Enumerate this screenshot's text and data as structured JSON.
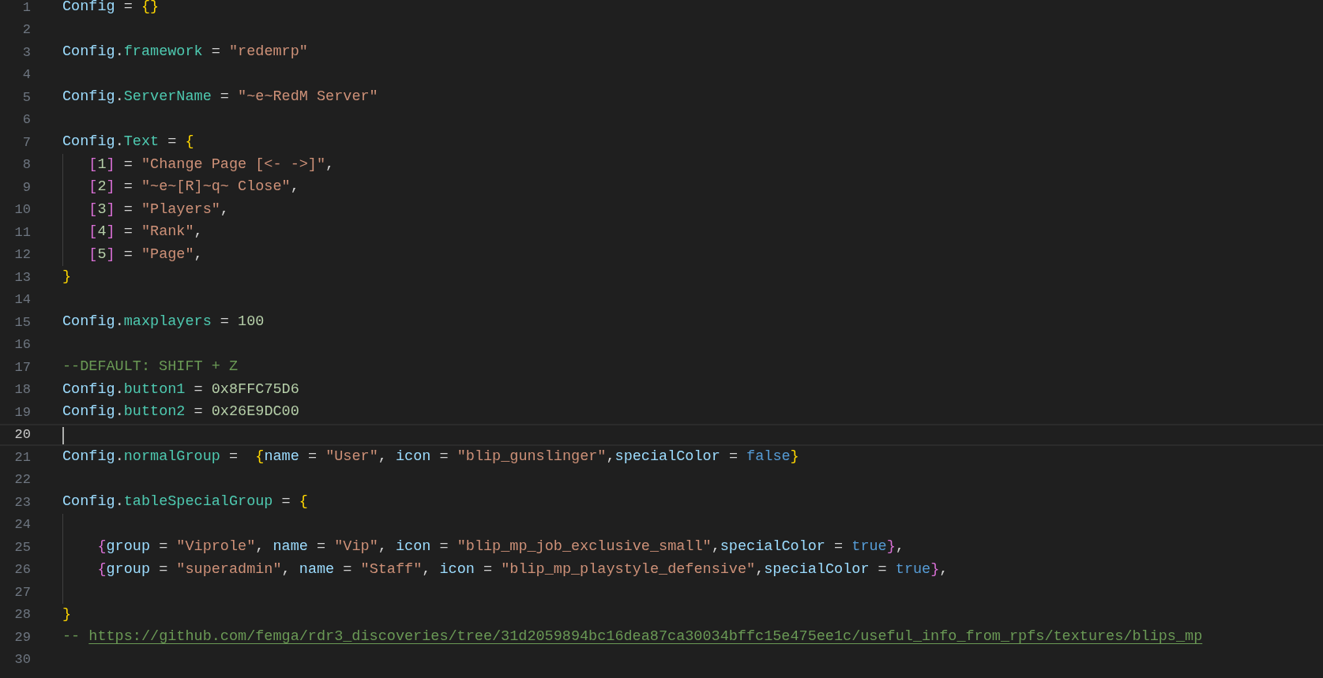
{
  "editor": {
    "lines": [
      {
        "number": "1",
        "current": false,
        "indent_guide": false,
        "tokens": [
          {
            "kind": "v",
            "text": "Config"
          },
          {
            "kind": "o",
            "text": " = "
          },
          {
            "kind": "b1",
            "text": "{}"
          }
        ]
      },
      {
        "number": "2",
        "current": false,
        "indent_guide": false
      },
      {
        "number": "3",
        "current": false,
        "indent_guide": false,
        "tokens": [
          {
            "kind": "v",
            "text": "Config"
          },
          {
            "kind": "o",
            "text": "."
          },
          {
            "kind": "f",
            "text": "framework"
          },
          {
            "kind": "o",
            "text": " = "
          },
          {
            "kind": "s",
            "text": "\"redemrp\""
          }
        ]
      },
      {
        "number": "4",
        "current": false,
        "indent_guide": false
      },
      {
        "number": "5",
        "current": false,
        "indent_guide": false,
        "tokens": [
          {
            "kind": "v",
            "text": "Config"
          },
          {
            "kind": "o",
            "text": "."
          },
          {
            "kind": "f",
            "text": "ServerName"
          },
          {
            "kind": "o",
            "text": " = "
          },
          {
            "kind": "s",
            "text": "\"~e~RedM Server\""
          }
        ]
      },
      {
        "number": "6",
        "current": false,
        "indent_guide": false
      },
      {
        "number": "7",
        "current": false,
        "indent_guide": false,
        "tokens": [
          {
            "kind": "v",
            "text": "Config"
          },
          {
            "kind": "o",
            "text": "."
          },
          {
            "kind": "f",
            "text": "Text"
          },
          {
            "kind": "o",
            "text": " = "
          },
          {
            "kind": "b1",
            "text": "{"
          }
        ]
      },
      {
        "number": "8",
        "current": false,
        "indent_guide": true,
        "kind": "entry",
        "tokens": [
          {
            "kind": "b2",
            "text": "["
          },
          {
            "kind": "n",
            "text": "1"
          },
          {
            "kind": "b2",
            "text": "]"
          },
          {
            "kind": "o",
            "text": " = "
          },
          {
            "kind": "s",
            "text": "\"Change Page [<- ->]\""
          },
          {
            "kind": "o",
            "text": ","
          }
        ]
      },
      {
        "number": "9",
        "current": false,
        "indent_guide": true,
        "kind": "entry",
        "tokens": [
          {
            "kind": "b2",
            "text": "["
          },
          {
            "kind": "n",
            "text": "2"
          },
          {
            "kind": "b2",
            "text": "]"
          },
          {
            "kind": "o",
            "text": " = "
          },
          {
            "kind": "s",
            "text": "\"~e~[R]~q~ Close\""
          },
          {
            "kind": "o",
            "text": ","
          }
        ]
      },
      {
        "number": "10",
        "current": false,
        "indent_guide": true,
        "kind": "entry",
        "tokens": [
          {
            "kind": "b2",
            "text": "["
          },
          {
            "kind": "n",
            "text": "3"
          },
          {
            "kind": "b2",
            "text": "]"
          },
          {
            "kind": "o",
            "text": " = "
          },
          {
            "kind": "s",
            "text": "\"Players\""
          },
          {
            "kind": "o",
            "text": ","
          }
        ]
      },
      {
        "number": "11",
        "current": false,
        "indent_guide": true,
        "kind": "entry",
        "tokens": [
          {
            "kind": "b2",
            "text": "["
          },
          {
            "kind": "n",
            "text": "4"
          },
          {
            "kind": "b2",
            "text": "]"
          },
          {
            "kind": "o",
            "text": " = "
          },
          {
            "kind": "s",
            "text": "\"Rank\""
          },
          {
            "kind": "o",
            "text": ","
          }
        ]
      },
      {
        "number": "12",
        "current": false,
        "indent_guide": true,
        "kind": "entry",
        "tokens": [
          {
            "kind": "b2",
            "text": "["
          },
          {
            "kind": "n",
            "text": "5"
          },
          {
            "kind": "b2",
            "text": "]"
          },
          {
            "kind": "o",
            "text": " = "
          },
          {
            "kind": "s",
            "text": "\"Page\""
          },
          {
            "kind": "o",
            "text": ","
          }
        ]
      },
      {
        "number": "13",
        "current": false,
        "indent_guide": false,
        "tokens": [
          {
            "kind": "b1",
            "text": "}"
          }
        ]
      },
      {
        "number": "14",
        "current": false,
        "indent_guide": false
      },
      {
        "number": "15",
        "current": false,
        "indent_guide": false,
        "tokens": [
          {
            "kind": "v",
            "text": "Config"
          },
          {
            "kind": "o",
            "text": "."
          },
          {
            "kind": "f",
            "text": "maxplayers"
          },
          {
            "kind": "o",
            "text": " = "
          },
          {
            "kind": "n",
            "text": "100"
          }
        ]
      },
      {
        "number": "16",
        "current": false,
        "indent_guide": false
      },
      {
        "number": "17",
        "current": false,
        "indent_guide": false,
        "tokens": [
          {
            "kind": "c",
            "text": "--DEFAULT: SHIFT + Z"
          }
        ]
      },
      {
        "number": "18",
        "current": false,
        "indent_guide": false,
        "tokens": [
          {
            "kind": "v",
            "text": "Config"
          },
          {
            "kind": "o",
            "text": "."
          },
          {
            "kind": "f",
            "text": "button1"
          },
          {
            "kind": "o",
            "text": " = "
          },
          {
            "kind": "n",
            "text": "0x8FFC75D6"
          }
        ]
      },
      {
        "number": "19",
        "current": false,
        "indent_guide": false,
        "tokens": [
          {
            "kind": "v",
            "text": "Config"
          },
          {
            "kind": "o",
            "text": "."
          },
          {
            "kind": "f",
            "text": "button2"
          },
          {
            "kind": "o",
            "text": " = "
          },
          {
            "kind": "n",
            "text": "0x26E9DC00"
          }
        ]
      },
      {
        "number": "20",
        "current": true,
        "indent_guide": false
      },
      {
        "number": "21",
        "current": false,
        "indent_guide": false,
        "tokens": [
          {
            "kind": "v",
            "text": "Config"
          },
          {
            "kind": "o",
            "text": "."
          },
          {
            "kind": "f",
            "text": "normalGroup"
          },
          {
            "kind": "o",
            "text": " =  "
          },
          {
            "kind": "b1",
            "text": "{"
          },
          {
            "kind": "v",
            "text": "name"
          },
          {
            "kind": "o",
            "text": " = "
          },
          {
            "kind": "s",
            "text": "\"User\""
          },
          {
            "kind": "o",
            "text": ", "
          },
          {
            "kind": "v",
            "text": "icon"
          },
          {
            "kind": "o",
            "text": " = "
          },
          {
            "kind": "s",
            "text": "\"blip_gunslinger\""
          },
          {
            "kind": "o",
            "text": ","
          },
          {
            "kind": "v",
            "text": "specialColor"
          },
          {
            "kind": "o",
            "text": " = "
          },
          {
            "kind": "k",
            "text": "false"
          },
          {
            "kind": "b1",
            "text": "}"
          }
        ]
      },
      {
        "number": "22",
        "current": false,
        "indent_guide": false
      },
      {
        "number": "23",
        "current": false,
        "indent_guide": false,
        "tokens": [
          {
            "kind": "v",
            "text": "Config"
          },
          {
            "kind": "o",
            "text": "."
          },
          {
            "kind": "f",
            "text": "tableSpecialGroup"
          },
          {
            "kind": "o",
            "text": " = "
          },
          {
            "kind": "b1",
            "text": "{"
          }
        ]
      },
      {
        "number": "24",
        "current": false,
        "indent_guide": true
      },
      {
        "number": "25",
        "current": false,
        "indent_guide": true,
        "kind": "record",
        "tokens": [
          {
            "kind": "b2",
            "text": "{"
          },
          {
            "kind": "v",
            "text": "group"
          },
          {
            "kind": "o",
            "text": " = "
          },
          {
            "kind": "s",
            "text": "\"Viprole\""
          },
          {
            "kind": "o",
            "text": ", "
          },
          {
            "kind": "v",
            "text": "name"
          },
          {
            "kind": "o",
            "text": " = "
          },
          {
            "kind": "s",
            "text": "\"Vip\""
          },
          {
            "kind": "o",
            "text": ", "
          },
          {
            "kind": "v",
            "text": "icon"
          },
          {
            "kind": "o",
            "text": " = "
          },
          {
            "kind": "s",
            "text": "\"blip_mp_job_exclusive_small\""
          },
          {
            "kind": "o",
            "text": ","
          },
          {
            "kind": "v",
            "text": "specialColor"
          },
          {
            "kind": "o",
            "text": " = "
          },
          {
            "kind": "k",
            "text": "true"
          },
          {
            "kind": "b2",
            "text": "}"
          },
          {
            "kind": "o",
            "text": ","
          }
        ]
      },
      {
        "number": "26",
        "current": false,
        "indent_guide": true,
        "kind": "record",
        "tokens": [
          {
            "kind": "b2",
            "text": "{"
          },
          {
            "kind": "v",
            "text": "group"
          },
          {
            "kind": "o",
            "text": " = "
          },
          {
            "kind": "s",
            "text": "\"superadmin\""
          },
          {
            "kind": "o",
            "text": ", "
          },
          {
            "kind": "v",
            "text": "name"
          },
          {
            "kind": "o",
            "text": " = "
          },
          {
            "kind": "s",
            "text": "\"Staff\""
          },
          {
            "kind": "o",
            "text": ", "
          },
          {
            "kind": "v",
            "text": "icon"
          },
          {
            "kind": "o",
            "text": " = "
          },
          {
            "kind": "s",
            "text": "\"blip_mp_playstyle_defensive\""
          },
          {
            "kind": "o",
            "text": ","
          },
          {
            "kind": "v",
            "text": "specialColor"
          },
          {
            "kind": "o",
            "text": " = "
          },
          {
            "kind": "k",
            "text": "true"
          },
          {
            "kind": "b2",
            "text": "}"
          },
          {
            "kind": "o",
            "text": ","
          }
        ]
      },
      {
        "number": "27",
        "current": false,
        "indent_guide": true
      },
      {
        "number": "28",
        "current": false,
        "indent_guide": false,
        "tokens": [
          {
            "kind": "b1",
            "text": "}"
          }
        ]
      },
      {
        "number": "29",
        "current": false,
        "indent_guide": false,
        "tokens": [
          {
            "kind": "c",
            "text": "-- "
          },
          {
            "kind": "l",
            "text": "https://github.com/femga/rdr3_discoveries/tree/31d2059894bc16dea87ca30034bffc15e475ee1c/useful_info_from_rpfs/textures/blips_mp"
          }
        ]
      },
      {
        "number": "30",
        "current": false,
        "indent_guide": false
      }
    ]
  }
}
